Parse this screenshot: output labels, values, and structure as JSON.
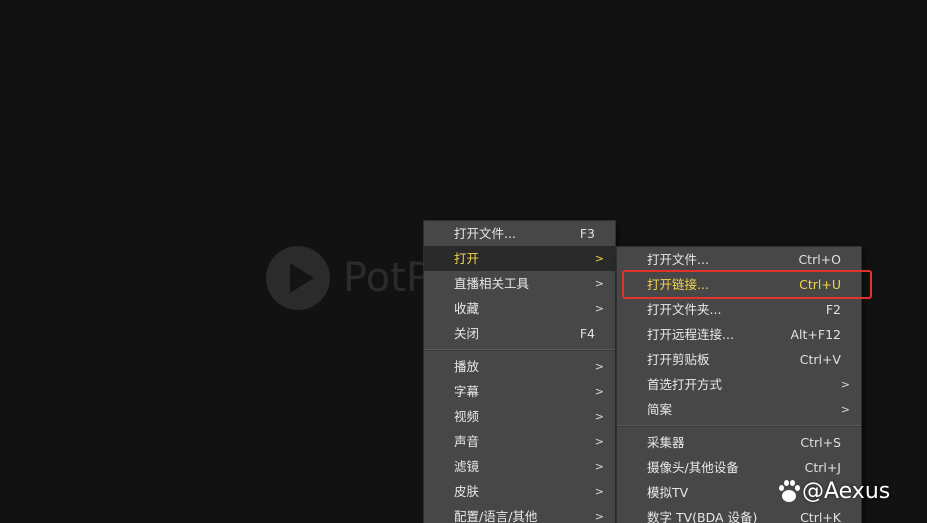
{
  "background": {
    "logo_text": "PotP"
  },
  "main_menu": {
    "items": [
      {
        "label": "打开文件...",
        "shortcut": "F3",
        "submenu": false
      },
      {
        "label": "打开",
        "shortcut": "",
        "submenu": true,
        "active": true
      },
      {
        "label": "直播相关工具",
        "shortcut": "",
        "submenu": true
      },
      {
        "label": "收藏",
        "shortcut": "",
        "submenu": true
      },
      {
        "label": "关闭",
        "shortcut": "F4",
        "submenu": false
      },
      {
        "label": "播放",
        "shortcut": "",
        "submenu": true
      },
      {
        "label": "字幕",
        "shortcut": "",
        "submenu": true
      },
      {
        "label": "视频",
        "shortcut": "",
        "submenu": true
      },
      {
        "label": "声音",
        "shortcut": "",
        "submenu": true
      },
      {
        "label": "滤镜",
        "shortcut": "",
        "submenu": true
      },
      {
        "label": "皮肤",
        "shortcut": "",
        "submenu": true
      },
      {
        "label": "配置/语言/其他",
        "shortcut": "",
        "submenu": true
      }
    ]
  },
  "open_submenu": {
    "items": [
      {
        "label": "打开文件...",
        "shortcut": "Ctrl+O"
      },
      {
        "label": "打开链接...",
        "shortcut": "Ctrl+U",
        "highlighted": true
      },
      {
        "label": "打开文件夹...",
        "shortcut": "F2"
      },
      {
        "label": "打开远程连接...",
        "shortcut": "Alt+F12"
      },
      {
        "label": "打开剪贴板",
        "shortcut": "Ctrl+V"
      },
      {
        "label": "首选打开方式",
        "shortcut": "",
        "submenu": true
      },
      {
        "label": "简案",
        "shortcut": "",
        "submenu": true
      },
      {
        "label": "采集器",
        "shortcut": "Ctrl+S"
      },
      {
        "label": "摄像头/其他设备",
        "shortcut": "Ctrl+J"
      },
      {
        "label": "模拟TV",
        "shortcut": ""
      },
      {
        "label": "数字 TV(BDA 设备)",
        "shortcut": "Ctrl+K"
      }
    ]
  },
  "arrow_glyph": ">",
  "watermark": {
    "text": "@Aexus",
    "icon": "baidu-paw-icon"
  },
  "colors": {
    "highlight_text": "#f1d54b",
    "annotation_box": "#e0332e",
    "menu_bg": "#474747",
    "app_bg": "#121212"
  }
}
